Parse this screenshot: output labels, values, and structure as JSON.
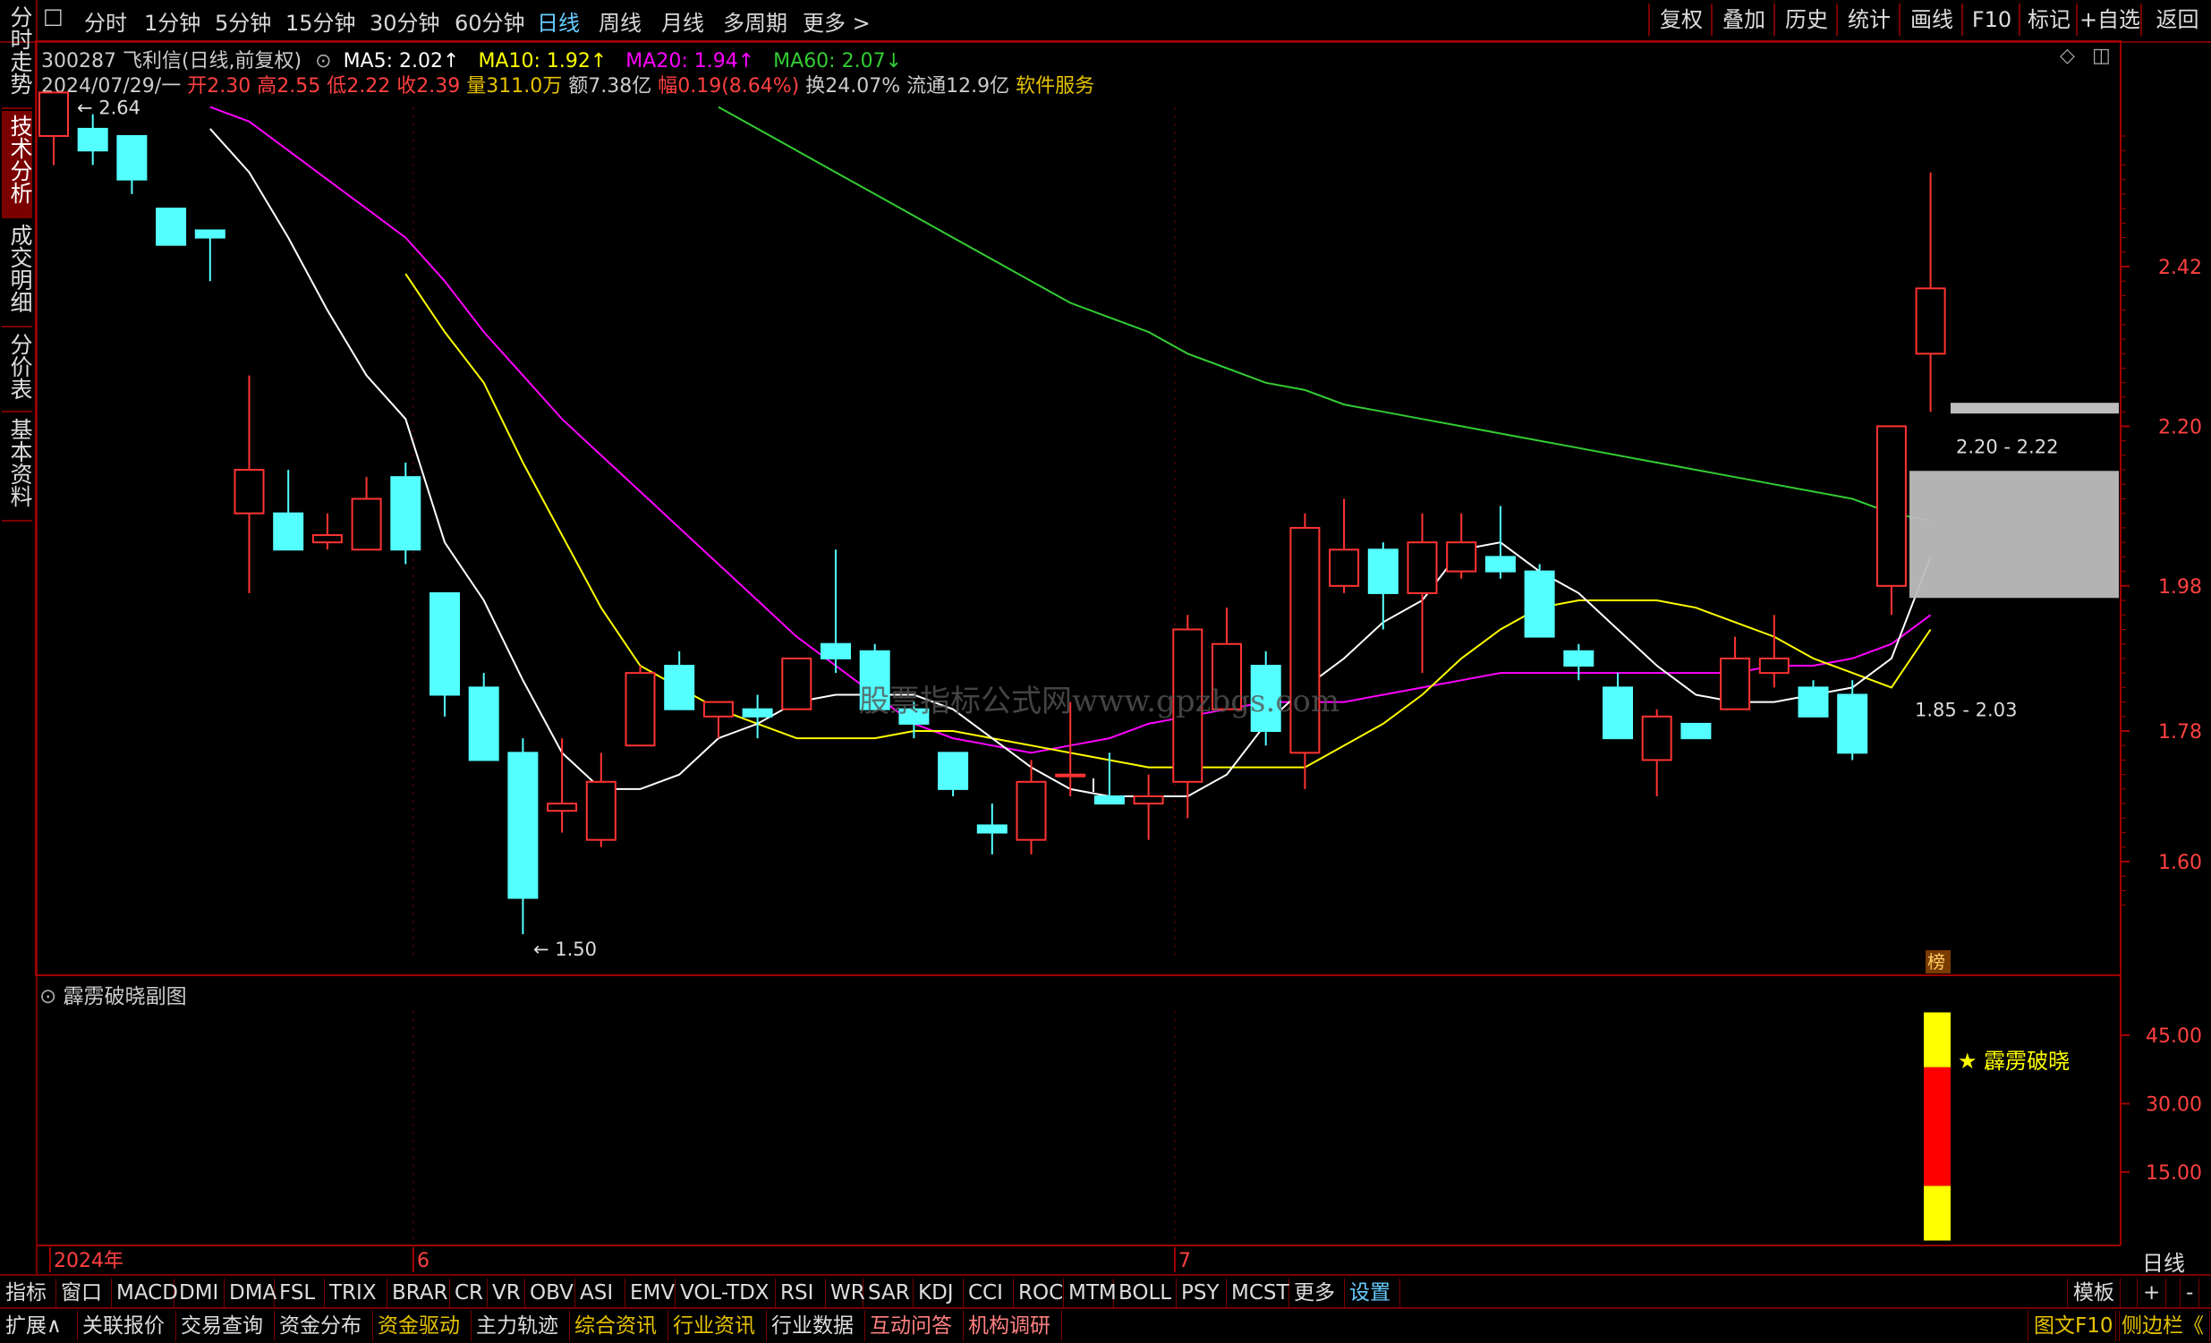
{
  "topbar": {
    "periods": [
      "分时",
      "1分钟",
      "5分钟",
      "15分钟",
      "30分钟",
      "60分钟",
      "日线",
      "周线",
      "月线",
      "多周期",
      "更多 >"
    ],
    "active_period": "日线",
    "right_buttons": [
      "复权",
      "叠加",
      "历史",
      "统计",
      "画线",
      "F10",
      "标记",
      "+自选",
      "返回"
    ]
  },
  "left_tabs": [
    {
      "label": "分时走势",
      "active": false
    },
    {
      "label": "技术分析",
      "active": true
    },
    {
      "label": "成交明细",
      "active": false
    },
    {
      "label": "分价表",
      "active": false
    },
    {
      "label": "基本资料",
      "active": false
    }
  ],
  "header": {
    "stock": "300287 飞利信(日线,前复权)",
    "ma5": "MA5: 2.02↑",
    "ma10": "MA10: 1.92↑",
    "ma20": "MA20: 1.94↑",
    "ma60": "MA60: 2.07↓",
    "date": "2024/07/29/一",
    "open": "开2.30",
    "high": "高2.55",
    "low": "低2.22",
    "close": "收2.39",
    "volume": "量311.0万",
    "amount": "额7.38亿",
    "change": "幅0.19(8.64%)",
    "turnover": "换24.07%",
    "float": "流通12.9亿",
    "industry": "软件服务"
  },
  "colors": {
    "up": "#ff3333",
    "down": "#54ffff",
    "ma5": "#ffffff",
    "ma10": "#ffff00",
    "ma20": "#ff00ff",
    "ma60": "#33cc33",
    "grid": "#800000",
    "axis_text": "#ff4040"
  },
  "watermark": "股票指标公式网www.gpzbgs.com",
  "chart_data": [
    {
      "type": "candlestick",
      "title": "",
      "ylim": [
        1.46,
        2.72
      ],
      "y_ticks": [
        "2.42",
        "2.20",
        "1.98",
        "1.78",
        "1.60"
      ],
      "x_labels": [
        "2024年",
        "6",
        "7"
      ],
      "candles": [
        {
          "o": 2.6,
          "h": 2.66,
          "l": 2.56,
          "c": 2.66
        },
        {
          "o": 2.61,
          "h": 2.63,
          "l": 2.56,
          "c": 2.58
        },
        {
          "o": 2.6,
          "h": 2.6,
          "l": 2.52,
          "c": 2.54
        },
        {
          "o": 2.5,
          "h": 2.5,
          "l": 2.45,
          "c": 2.45
        },
        {
          "o": 2.47,
          "h": 2.47,
          "l": 2.4,
          "c": 2.46
        },
        {
          "o": 2.08,
          "h": 2.27,
          "l": 1.97,
          "c": 2.14
        },
        {
          "o": 2.08,
          "h": 2.14,
          "l": 2.03,
          "c": 2.03
        },
        {
          "o": 2.04,
          "h": 2.08,
          "l": 2.03,
          "c": 2.05
        },
        {
          "o": 2.03,
          "h": 2.13,
          "l": 2.03,
          "c": 2.1
        },
        {
          "o": 2.13,
          "h": 2.15,
          "l": 2.01,
          "c": 2.03
        },
        {
          "o": 1.97,
          "h": 1.97,
          "l": 1.8,
          "c": 1.83
        },
        {
          "o": 1.84,
          "h": 1.86,
          "l": 1.75,
          "c": 1.74
        },
        {
          "o": 1.75,
          "h": 1.77,
          "l": 1.5,
          "c": 1.55
        },
        {
          "o": 1.67,
          "h": 1.77,
          "l": 1.64,
          "c": 1.68
        },
        {
          "o": 1.63,
          "h": 1.75,
          "l": 1.62,
          "c": 1.71
        },
        {
          "o": 1.76,
          "h": 1.87,
          "l": 1.76,
          "c": 1.86
        },
        {
          "o": 1.87,
          "h": 1.89,
          "l": 1.81,
          "c": 1.81
        },
        {
          "o": 1.8,
          "h": 1.82,
          "l": 1.77,
          "c": 1.82
        },
        {
          "o": 1.81,
          "h": 1.83,
          "l": 1.77,
          "c": 1.8
        },
        {
          "o": 1.81,
          "h": 1.88,
          "l": 1.81,
          "c": 1.88
        },
        {
          "o": 1.9,
          "h": 2.03,
          "l": 1.86,
          "c": 1.88
        },
        {
          "o": 1.89,
          "h": 1.9,
          "l": 1.82,
          "c": 1.81
        },
        {
          "o": 1.81,
          "h": 1.82,
          "l": 1.77,
          "c": 1.79
        },
        {
          "o": 1.75,
          "h": 1.75,
          "l": 1.69,
          "c": 1.7
        },
        {
          "o": 1.65,
          "h": 1.68,
          "l": 1.61,
          "c": 1.64
        },
        {
          "o": 1.63,
          "h": 1.74,
          "l": 1.61,
          "c": 1.71
        },
        {
          "o": 1.72,
          "h": 1.82,
          "l": 1.69,
          "c": 1.72
        },
        {
          "o": 1.69,
          "h": 1.75,
          "l": 1.68,
          "c": 1.68
        },
        {
          "o": 1.68,
          "h": 1.72,
          "l": 1.63,
          "c": 1.69
        },
        {
          "o": 1.71,
          "h": 1.94,
          "l": 1.66,
          "c": 1.92
        },
        {
          "o": 1.81,
          "h": 1.95,
          "l": 1.81,
          "c": 1.9
        },
        {
          "o": 1.87,
          "h": 1.89,
          "l": 1.76,
          "c": 1.78
        },
        {
          "o": 1.75,
          "h": 2.08,
          "l": 1.7,
          "c": 2.06
        },
        {
          "o": 1.98,
          "h": 2.1,
          "l": 1.97,
          "c": 2.03
        },
        {
          "o": 2.03,
          "h": 2.04,
          "l": 1.92,
          "c": 1.97
        },
        {
          "o": 1.97,
          "h": 2.08,
          "l": 1.86,
          "c": 2.04
        },
        {
          "o": 2.0,
          "h": 2.08,
          "l": 1.99,
          "c": 2.04
        },
        {
          "o": 2.02,
          "h": 2.09,
          "l": 1.99,
          "c": 2.0
        },
        {
          "o": 2.0,
          "h": 2.01,
          "l": 1.91,
          "c": 1.91
        },
        {
          "o": 1.89,
          "h": 1.9,
          "l": 1.85,
          "c": 1.87
        },
        {
          "o": 1.84,
          "h": 1.86,
          "l": 1.77,
          "c": 1.77
        },
        {
          "o": 1.74,
          "h": 1.81,
          "l": 1.69,
          "c": 1.8
        },
        {
          "o": 1.79,
          "h": 1.79,
          "l": 1.77,
          "c": 1.77
        },
        {
          "o": 1.81,
          "h": 1.91,
          "l": 1.81,
          "c": 1.88
        },
        {
          "o": 1.86,
          "h": 1.94,
          "l": 1.84,
          "c": 1.88
        },
        {
          "o": 1.84,
          "h": 1.85,
          "l": 1.81,
          "c": 1.8
        },
        {
          "o": 1.83,
          "h": 1.85,
          "l": 1.74,
          "c": 1.75
        },
        {
          "o": 1.98,
          "h": 2.2,
          "l": 1.94,
          "c": 2.2
        },
        {
          "o": 2.3,
          "h": 2.55,
          "l": 2.22,
          "c": 2.39
        }
      ],
      "ma5": [
        null,
        null,
        null,
        null,
        2.61,
        2.55,
        2.46,
        2.36,
        2.27,
        2.21,
        2.04,
        1.96,
        1.85,
        1.75,
        1.7,
        1.7,
        1.72,
        1.77,
        1.79,
        1.82,
        1.83,
        1.83,
        1.83,
        1.81,
        1.77,
        1.73,
        1.7,
        1.69,
        1.69,
        1.69,
        1.72,
        1.79,
        1.84,
        1.88,
        1.93,
        1.96,
        2.03,
        2.04,
        2.0,
        1.97,
        1.92,
        1.87,
        1.83,
        1.82,
        1.82,
        1.83,
        1.84,
        1.88,
        2.02
      ],
      "ma10": [
        null,
        null,
        null,
        null,
        null,
        null,
        null,
        null,
        null,
        2.41,
        2.33,
        2.26,
        2.15,
        2.05,
        1.95,
        1.87,
        1.84,
        1.81,
        1.79,
        1.77,
        1.77,
        1.77,
        1.78,
        1.78,
        1.77,
        1.76,
        1.75,
        1.74,
        1.73,
        1.73,
        1.73,
        1.73,
        1.73,
        1.76,
        1.79,
        1.83,
        1.88,
        1.92,
        1.95,
        1.96,
        1.96,
        1.96,
        1.95,
        1.93,
        1.91,
        1.88,
        1.86,
        1.84,
        1.92
      ],
      "ma20": [
        null,
        null,
        null,
        null,
        2.64,
        2.62,
        2.58,
        2.54,
        2.5,
        2.46,
        2.4,
        2.33,
        2.27,
        2.21,
        2.16,
        2.11,
        2.06,
        2.01,
        1.96,
        1.91,
        1.87,
        1.83,
        1.79,
        1.77,
        1.76,
        1.75,
        1.76,
        1.77,
        1.79,
        1.8,
        1.81,
        1.82,
        1.82,
        1.82,
        1.83,
        1.84,
        1.85,
        1.86,
        1.86,
        1.86,
        1.86,
        1.86,
        1.86,
        1.86,
        1.87,
        1.87,
        1.88,
        1.9,
        1.94
      ],
      "ma60": [
        null,
        null,
        null,
        null,
        null,
        null,
        null,
        null,
        null,
        null,
        null,
        null,
        null,
        null,
        null,
        null,
        null,
        2.64,
        2.61,
        2.58,
        2.55,
        2.52,
        2.49,
        2.46,
        2.43,
        2.4,
        2.37,
        2.35,
        2.33,
        2.3,
        2.28,
        2.26,
        2.25,
        2.23,
        2.22,
        2.21,
        2.2,
        2.19,
        2.18,
        2.17,
        2.16,
        2.15,
        2.14,
        2.13,
        2.12,
        2.11,
        2.1,
        2.08,
        2.07
      ],
      "annotations": [
        {
          "label": "2.64",
          "value": 2.64
        },
        {
          "label": "1.50",
          "value": 1.5
        },
        {
          "label": "2.20 - 2.22",
          "range": [
            2.2,
            2.22
          ]
        },
        {
          "label": "1.85 - 2.03",
          "range": [
            1.85,
            2.03
          ]
        }
      ],
      "marker": "榜"
    },
    {
      "type": "bar",
      "title": "霹雳破晓副图",
      "ylim": [
        0,
        52
      ],
      "y_ticks": [
        "45.00",
        "30.00",
        "15.00"
      ],
      "series": [
        {
          "name": "霹雳破晓",
          "segments": [
            {
              "from": 0,
              "to": 12,
              "color": "#ffff00"
            },
            {
              "from": 12,
              "to": 38,
              "color": "#ff0000"
            },
            {
              "from": 38,
              "to": 50,
              "color": "#ffff00"
            }
          ]
        }
      ],
      "legend_text": "★ 霹雳破晓"
    }
  ],
  "bottom_tabs": [
    "指标",
    "窗口",
    "MACD",
    "DMI",
    "DMA",
    "FSL",
    "TRIX",
    "BRAR",
    "CR",
    "VR",
    "OBV",
    "ASI",
    "EMV",
    "VOL-TDX",
    "RSI",
    "WR",
    "SAR",
    "KDJ",
    "CCI",
    "ROC",
    "MTM",
    "BOLL",
    "PSY",
    "MCST",
    "更多",
    "设置"
  ],
  "bottom_right": [
    "模板",
    "+",
    "-"
  ],
  "axis_period_label": "日线",
  "bottom_bar2": [
    "扩展∧",
    "关联报价",
    "交易查询",
    "资金分布",
    "资金驱动",
    "主力轨迹",
    "综合资讯",
    "行业资讯",
    "行业数据",
    "互动问答",
    "机构调研"
  ],
  "bottom_bar2_right": [
    "图文F10",
    "侧边栏《"
  ]
}
